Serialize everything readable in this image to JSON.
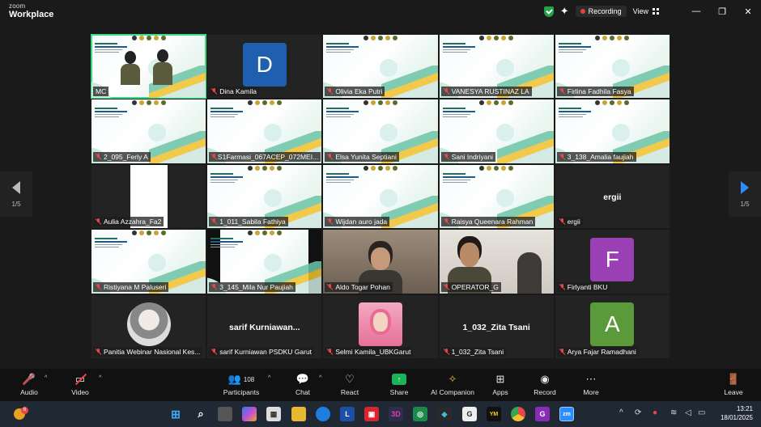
{
  "app": {
    "brand_line1": "zoom",
    "brand_line2": "Workplace"
  },
  "titlebar": {
    "recording_label": "Recording",
    "view_label": "View"
  },
  "pager": {
    "left": "1/5",
    "right": "1/5"
  },
  "tiles": [
    {
      "name": "MC",
      "kind": "camera-slide",
      "muted": false
    },
    {
      "name": "Dina Kamila",
      "kind": "avatar",
      "letter": "D",
      "muted": true
    },
    {
      "name": "Olivia Eka Putri",
      "kind": "slide",
      "muted": true
    },
    {
      "name": "VANESYA RUSTINAZ LA",
      "kind": "slide",
      "muted": true
    },
    {
      "name": "Firlina Fadhila Fasya",
      "kind": "slide",
      "muted": true
    },
    {
      "name": "2_095_Ferly A",
      "kind": "slide",
      "muted": true
    },
    {
      "name": "S1Farmasi_067ACEP_072MEI...",
      "kind": "slide",
      "muted": true
    },
    {
      "name": "Elsa Yunita Septiani",
      "kind": "slide",
      "muted": true
    },
    {
      "name": "Sani Indriyani",
      "kind": "slide",
      "muted": true
    },
    {
      "name": "3_138_Amalia faujiah",
      "kind": "slide",
      "muted": true
    },
    {
      "name": "Aulia Azzahra_Fa2",
      "kind": "white",
      "muted": true
    },
    {
      "name": "1_011_Sabila Fathiya",
      "kind": "slide",
      "muted": true
    },
    {
      "name": "Wijdan auro jada",
      "kind": "slide",
      "muted": true
    },
    {
      "name": "Raisya Queenara Rahman",
      "kind": "slide",
      "muted": true
    },
    {
      "name": "ergii",
      "kind": "text",
      "big": "ergii",
      "muted": true
    },
    {
      "name": "Ristiyana M Paluseri",
      "kind": "slide",
      "muted": true
    },
    {
      "name": "3_145_Mila Nur Paujiah",
      "kind": "slide-dark",
      "muted": true
    },
    {
      "name": "Aldo Togar Pohan",
      "kind": "camera",
      "muted": true
    },
    {
      "name": "OPERATOR_G",
      "kind": "camera2",
      "muted": true
    },
    {
      "name": "Firlyanti BKU",
      "kind": "avatar",
      "letter": "F",
      "muted": true
    },
    {
      "name": "Panitia Webinar Nasional Kes...",
      "kind": "photo-round",
      "muted": true
    },
    {
      "name": "sarif Kurniawan PSDKU Garut",
      "kind": "text",
      "big": "sarif  Kurniawan...",
      "muted": true
    },
    {
      "name": "Selmi Kamila_UBKGarut",
      "kind": "photo-rect",
      "muted": true
    },
    {
      "name": "1_032_Zita Tsani",
      "kind": "text",
      "big": "1_032_Zita Tsani",
      "muted": true
    },
    {
      "name": "Arya Fajar Ramadhani",
      "kind": "avatar",
      "letter": "A",
      "muted": true
    }
  ],
  "toolbar": {
    "audio": "Audio",
    "video": "Video",
    "participants": "Participants",
    "participant_count": "108",
    "chat": "Chat",
    "react": "React",
    "share": "Share",
    "ai": "AI Companion",
    "apps": "Apps",
    "record": "Record",
    "more": "More",
    "leave": "Leave"
  },
  "taskbar": {
    "time": "13:21",
    "date": "18/01/2025"
  }
}
